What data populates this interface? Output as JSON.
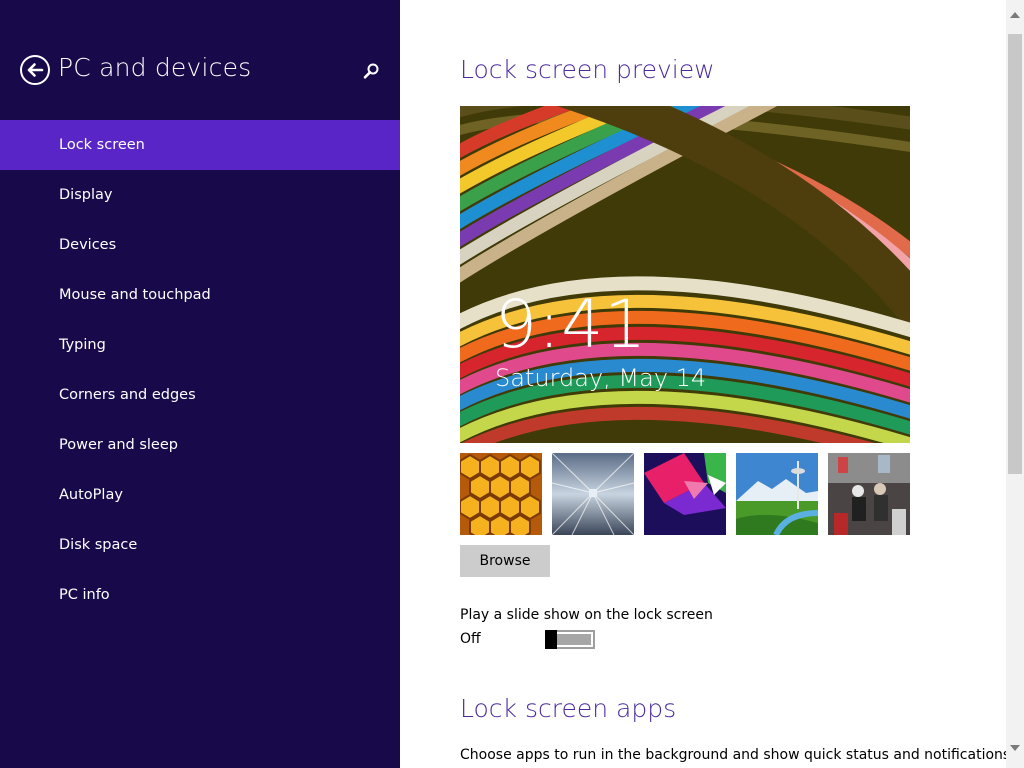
{
  "sidebar": {
    "title": "PC and devices",
    "back_icon": "back-arrow-icon",
    "search_icon": "search-icon",
    "bg_color": "#180a4a",
    "selected_color": "#5a25c7",
    "items": [
      {
        "label": "Lock screen",
        "selected": true
      },
      {
        "label": "Display"
      },
      {
        "label": "Devices"
      },
      {
        "label": "Mouse and touchpad"
      },
      {
        "label": "Typing"
      },
      {
        "label": "Corners and edges"
      },
      {
        "label": "Power and sleep"
      },
      {
        "label": "AutoPlay"
      },
      {
        "label": "Disk space"
      },
      {
        "label": "PC info"
      }
    ]
  },
  "main": {
    "preview_heading": "Lock screen preview",
    "clock_time": "9:41",
    "clock_date": "Saturday, May 14",
    "thumbnails": [
      "honeycomb",
      "train-tunnel",
      "geometric-shapes",
      "mountain-tower",
      "festival-street"
    ],
    "browse_label": "Browse",
    "slideshow_label": "Play a slide show on the lock screen",
    "slideshow_state": "Off",
    "apps_heading": "Lock screen apps",
    "apps_desc": "Choose apps to run in the background and show quick status and notifications,",
    "heading_color": "#4b2a9e"
  }
}
